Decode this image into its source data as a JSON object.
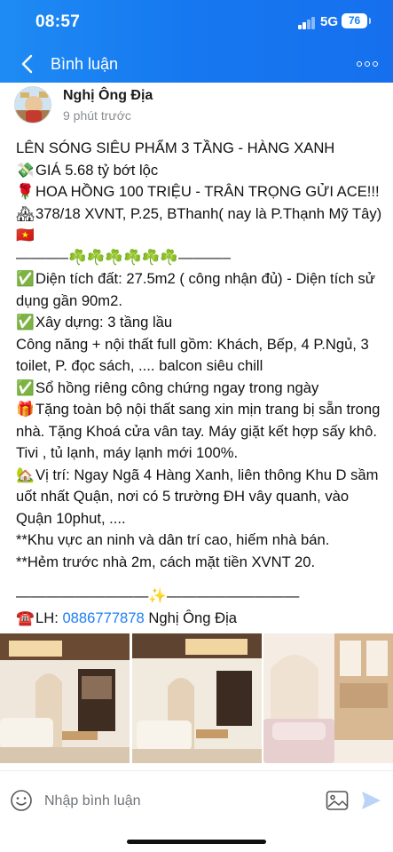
{
  "status_bar": {
    "time": "08:57",
    "network": "5G",
    "battery": "76"
  },
  "header": {
    "title": "Bình luận",
    "back_icon": "chevron-left-icon",
    "more_icon": "more-horizontal-icon"
  },
  "post": {
    "author": "Nghị Ông Địa",
    "time_ago": "9 phút trước",
    "lines": {
      "l1": "LÊN SÓNG SIÊU PHẨM 3 TẦNG - HÀNG XANH",
      "l2_emoji": "💸",
      "l2": "GIÁ 5.68 tỷ bớt lộc",
      "l3_emoji": "🌹",
      "l3": "HOA HỒNG 100 TRIỆU - TRÂN TRỌNG GỬI ACE!!!",
      "l4_emoji": "🏘",
      "l4": "378/18 XVNT, P.25, BThanh( nay là P.Thạnh Mỹ Tây)",
      "l4_flag": "🇻🇳",
      "divider1_left": "———–",
      "divider1_clovers": "☘️☘️☘️☘️☘️☘️",
      "divider1_right": "———–",
      "l5_emoji": "✅",
      "l5": "Diện tích đất: 27.5m2 ( công nhận đủ) - Diện tích sử dụng gần 90m2.",
      "l6_emoji": "✅",
      "l6": "Xây dựng: 3 tầng lầu",
      "l7": "Công năng + nội thất full gồm: Khách, Bếp, 4 P.Ngủ, 3 toilet, P. đọc sách, .... balcon siêu chill",
      "l8_emoji": "✅",
      "l8": "Sổ hồng riêng công chứng ngay trong ngày",
      "l9_emoji": "🎁",
      "l9": "Tặng toàn bộ nội thất sang xin mịn trang bị sẵn trong nhà. Tặng Khoá cửa vân tay. Máy giặt kết hợp sấy khô. Tivi , tủ lạnh, máy lạnh mới 100%.",
      "l10_emoji": "🏡",
      "l10": "Vị trí: Ngay Ngã 4 Hàng Xanh, liên thông Khu D sầm uốt nhất Quận, nơi có 5 trường ĐH vây quanh, vào Quận 10phut, ....",
      "l11": "**Khu vực an ninh và dân trí cao, hiếm nhà bán.",
      "l12": "**Hẻm trước nhà 2m, cách mặt tiền XVNT 20.",
      "divider2_left": "—————————",
      "divider2_sparkle": "✨",
      "divider2_right": "—————————",
      "contact_emoji": "☎️",
      "contact_label": "LH:",
      "contact_phone": "0886777878",
      "contact_name": "Nghị Ông Địa"
    }
  },
  "comment_bar": {
    "placeholder": "Nhập bình luận",
    "emoji_icon": "smiley-icon",
    "image_icon": "image-icon",
    "send_icon": "send-icon"
  }
}
